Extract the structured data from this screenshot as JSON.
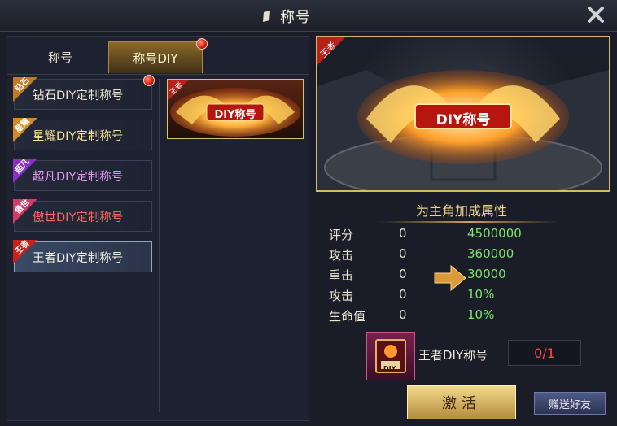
{
  "title": "称号",
  "tabs": [
    {
      "label": "称号"
    },
    {
      "label": "称号DIY"
    }
  ],
  "list_items": [
    {
      "tag": "钻石",
      "label": "钻石DIY定制称号",
      "color": "#f0e6d0",
      "flag_color": "#c47a24",
      "has_dot": true
    },
    {
      "tag": "星耀",
      "label": "星耀DIY定制称号",
      "color": "#f7e49a",
      "flag_color": "#d28a22",
      "has_dot": false
    },
    {
      "tag": "超凡",
      "label": "超凡DIY定制称号",
      "color": "#e79cf2",
      "flag_color": "#8b2fc9",
      "has_dot": false
    },
    {
      "tag": "傲世",
      "label": "傲世DIY定制称号",
      "color": "#ff6a66",
      "flag_color": "#d23a6a",
      "has_dot": false
    },
    {
      "tag": "王者",
      "label": "王者DIY定制称号",
      "color": "#f4f0e4",
      "flag_color": "#c8231b",
      "has_dot": false
    }
  ],
  "card": {
    "tag": "王者",
    "title": "DIY称号"
  },
  "preview": {
    "tag": "王者",
    "title": "DIY称号"
  },
  "attributes": {
    "title": "为主角加成属性",
    "rows": [
      {
        "name": "评分",
        "current": "0",
        "new": "4500000"
      },
      {
        "name": "攻击",
        "current": "0",
        "new": "360000"
      },
      {
        "name": "重击",
        "current": "0",
        "new": "30000"
      },
      {
        "name": "攻击",
        "current": "0",
        "new": "10%"
      },
      {
        "name": "生命值",
        "current": "0",
        "new": "10%"
      }
    ]
  },
  "reward": {
    "name": "王者DIY称号",
    "icon_text": "DIY",
    "count": "0/1"
  },
  "buttons": {
    "activate": "激活",
    "gift": "赠送好友"
  }
}
